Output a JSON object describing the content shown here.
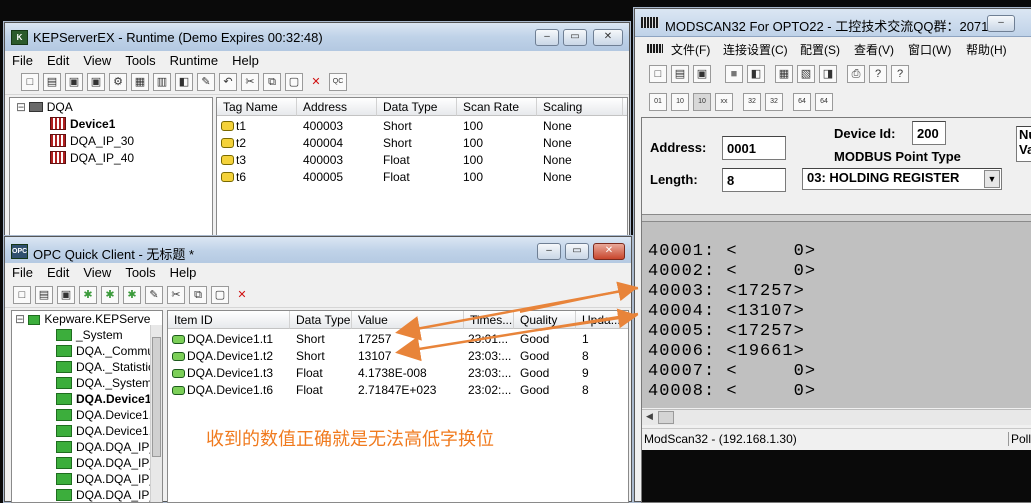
{
  "kep": {
    "title": "KEPServerEX - Runtime (Demo Expires 00:32:48)",
    "menu": [
      "File",
      "Edit",
      "View",
      "Tools",
      "Runtime",
      "Help"
    ],
    "tree": {
      "root": "DQA",
      "devices": [
        "Device1",
        "DQA_IP_30",
        "DQA_IP_40"
      ]
    },
    "columns": [
      "Tag Name",
      "Address",
      "Data Type",
      "Scan Rate",
      "Scaling"
    ],
    "rows": [
      {
        "name": "t1",
        "address": "400003",
        "type": "Short",
        "rate": "100",
        "scaling": "None"
      },
      {
        "name": "t2",
        "address": "400004",
        "type": "Short",
        "rate": "100",
        "scaling": "None"
      },
      {
        "name": "t3",
        "address": "400003",
        "type": "Float",
        "rate": "100",
        "scaling": "None"
      },
      {
        "name": "t6",
        "address": "400005",
        "type": "Float",
        "rate": "100",
        "scaling": "None"
      }
    ]
  },
  "opc": {
    "title": "OPC Quick Client - 无标题 *",
    "menu": [
      "File",
      "Edit",
      "View",
      "Tools",
      "Help"
    ],
    "tree": [
      "Kepware.KEPServe",
      "_System",
      "DQA._Communi",
      "DQA._Statistics",
      "DQA._System",
      "DQA.Device1",
      "DQA.Device1._",
      "DQA.Device1._",
      "DQA.DQA_IP_3",
      "DQA.DQA_IP_3",
      "DQA.DQA_IP_3",
      "DQA.DQA_IP_4"
    ],
    "columns": [
      "Item ID",
      "Data Type",
      "Value",
      "Times...",
      "Quality",
      "Upda..."
    ],
    "rows": [
      {
        "id": "DQA.Device1.t1",
        "type": "Short",
        "value": "17257",
        "time": "23:01...",
        "quality": "Good",
        "upd": "1"
      },
      {
        "id": "DQA.Device1.t2",
        "type": "Short",
        "value": "13107",
        "time": "23:03:...",
        "quality": "Good",
        "upd": "8"
      },
      {
        "id": "DQA.Device1.t3",
        "type": "Float",
        "value": "4.1738E-008",
        "time": "23:03:...",
        "quality": "Good",
        "upd": "9"
      },
      {
        "id": "DQA.Device1.t6",
        "type": "Float",
        "value": "2.71847E+023",
        "time": "23:02:...",
        "quality": "Good",
        "upd": "8"
      }
    ],
    "annotation": "收到的数值正确就是无法高低字换位"
  },
  "modscan": {
    "title": "MODSCAN32 For OPTO22 - 工控技术交流QQ群：2071...",
    "menu": [
      "文件(F)",
      "连接设置(C)",
      "配置(S)",
      "查看(V)",
      "窗口(W)",
      "帮助(H)"
    ],
    "address_label": "Address:",
    "address": "0001",
    "length_label": "Length:",
    "length": "8",
    "device_id_label": "Device Id:",
    "device_id": "200",
    "point_type_label": "MODBUS Point Type",
    "point_type": "03: HOLDING REGISTER",
    "side_label_1": "Nu",
    "side_label_2": "Va",
    "registers": [
      "40001: <     0>",
      "40002: <     0>",
      "40003: <17257>",
      "40004: <13107>",
      "40005: <17257>",
      "40006: <19661>",
      "40007: <     0>",
      "40008: <     0>"
    ],
    "status": "ModScan32 - (192.168.1.30)",
    "status_right": "Poll"
  },
  "colors": {
    "accent_arrow": "#e8843a",
    "annotation": "#f07a1e",
    "register_bg": "#c0c0c0"
  }
}
